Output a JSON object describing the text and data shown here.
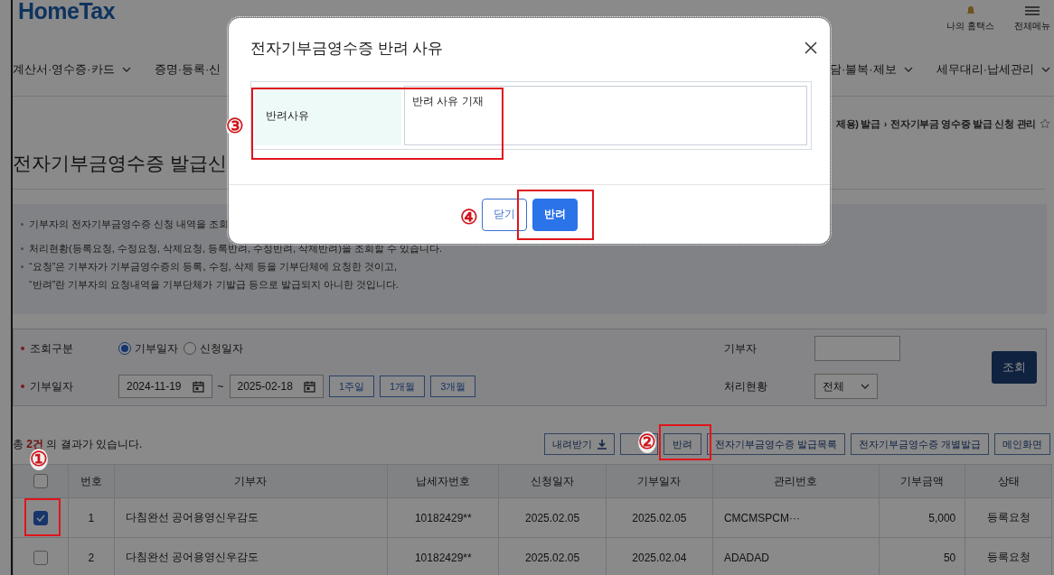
{
  "header": {
    "logo": "HomeTax",
    "links": [
      {
        "label": "나의 홈택스",
        "kind": "user"
      },
      {
        "label": "전체메뉴",
        "kind": "menu"
      }
    ]
  },
  "nav": {
    "left": [
      {
        "label": "계산서·영수증·카드",
        "caret": true
      },
      {
        "label": "증명·등록·신",
        "caret": false
      }
    ],
    "right": [
      {
        "label": "담·불복·제보",
        "caret": true
      },
      {
        "label": "세무대리·납세관리",
        "caret": true
      }
    ]
  },
  "breadcrumb": {
    "items": [
      "제용) 발급",
      "전자기부금 영수증 발급 신청 관리"
    ],
    "separator": "›"
  },
  "page_title": "전자기부금영수증 발급신",
  "notes": [
    {
      "text": "기부자의 전자기부금영수증 신청 내역을 조회",
      "bullet": true
    },
    {
      "text": "처리현황(등록요청, 수정요청, 삭제요청, 등록반려, 수정반려, 삭제반려)을 조회할 수 있습니다.",
      "bullet": true
    },
    {
      "text": "“요청”은 기부자가 기부금영수증의 등록, 수정, 삭제 등을 기부단체에 요청한 것이고,",
      "bullet": true
    },
    {
      "text": "“반려”란 기부자의 요청내역을 기부단체가 기발급 등으로 발급되지 아니한 것입니다.",
      "bullet": false
    }
  ],
  "search": {
    "query_type": {
      "label": "조회구분",
      "options": [
        {
          "label": "기부일자",
          "selected": true
        },
        {
          "label": "신청일자",
          "selected": false
        }
      ]
    },
    "donation_date": {
      "label": "기부일자",
      "from": "2024-11-19",
      "separator": "~",
      "to": "2025-02-18",
      "ranges": [
        "1주일",
        "1개월",
        "3개월"
      ]
    },
    "donor": {
      "label": "기부자"
    },
    "status": {
      "label": "처리현황",
      "value": "전체"
    },
    "search_button": "조회"
  },
  "results": "총 **2건** 의 결과가 있습니다.",
  "toolbar": [
    {
      "label": "내려받기",
      "kind": "download"
    },
    {
      "kind": "plain"
    },
    {
      "label": "반려",
      "kind": "plain"
    },
    {
      "label": "전자기부금영수증 발급목록",
      "kind": "plain"
    },
    {
      "label": "전자기부금영수증 개별발급",
      "kind": "plain"
    },
    {
      "label": "메인화면",
      "kind": "plain"
    }
  ],
  "table": {
    "all_checked": false,
    "columns": [
      "번호",
      "기부자",
      "납세자번호",
      "신청일자",
      "기부일자",
      "관리번호",
      "기부금액",
      "상태"
    ],
    "rows": [
      {
        "checked": true,
        "cells": [
          "1",
          "다침완선 공어용영신우감도",
          "10182429**",
          "2025.02.05",
          "2025.02.05",
          "CMCMSPCM···",
          "5,000",
          "등록요청"
        ]
      },
      {
        "checked": false,
        "cells": [
          "2",
          "다침완선 공어용영신우감도",
          "10182429**",
          "2025.02.05",
          "2025.02.04",
          "ADADAD",
          "50",
          "등록요청"
        ]
      }
    ]
  },
  "modal": {
    "title": "전자기부금영수증 반려 사유",
    "field_label": "반려사유",
    "field_value": "반려 사유 기재",
    "buttons": [
      {
        "label": "닫기",
        "kind": "secondary"
      },
      {
        "label": "반려",
        "kind": "primary"
      }
    ]
  },
  "annotations": [
    {
      "label": "③"
    },
    {
      "label": "④"
    },
    {
      "label": "②"
    },
    {
      "label": "①"
    }
  ]
}
